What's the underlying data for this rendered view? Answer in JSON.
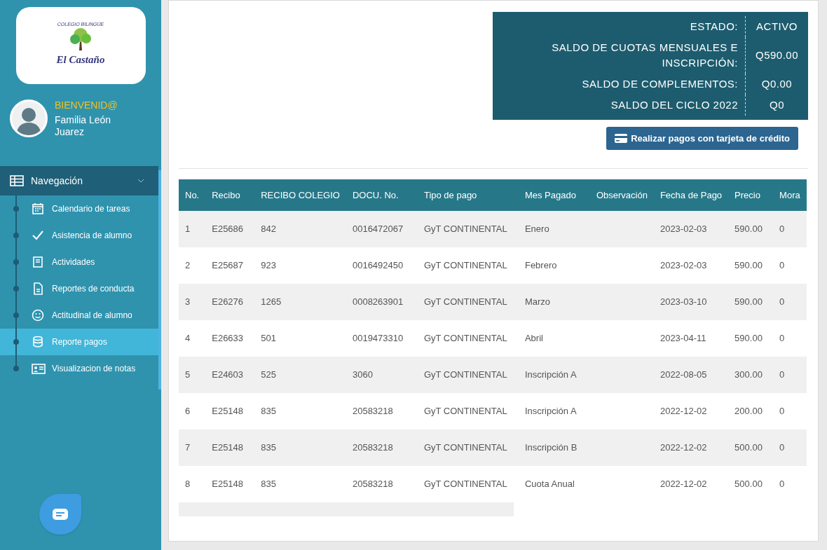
{
  "sidebar": {
    "logo": {
      "arc_text": "COLEGIO BILINGÜE",
      "name": "El Castaño"
    },
    "welcome": "BIENVENID@",
    "user_name": "Familia León Juarez",
    "nav_header": {
      "label": "Navegación",
      "expanded": true
    },
    "items": [
      {
        "label": "Calendario de tareas",
        "selected": false
      },
      {
        "label": "Asistencia de alumno",
        "selected": false
      },
      {
        "label": "Actividades",
        "selected": false
      },
      {
        "label": "Reportes de conducta",
        "selected": false
      },
      {
        "label": "Actitudinal de alumno",
        "selected": false
      },
      {
        "label": "Reporte pagos",
        "selected": true
      },
      {
        "label": "Visualizacion de notas",
        "selected": false
      }
    ]
  },
  "summary": [
    {
      "label": "ESTADO:",
      "value": "ACTIVO"
    },
    {
      "label": "SALDO DE CUOTAS MENSUALES E INSCRIPCIÓN:",
      "value": "Q590.00"
    },
    {
      "label": "SALDO DE COMPLEMENTOS:",
      "value": "Q0.00"
    },
    {
      "label": "SALDO DEL CICLO 2022",
      "value": "Q0"
    }
  ],
  "pay_button": "Realizar pagos con tarjeta de crédito",
  "table": {
    "columns": [
      "No.",
      "Recibo",
      "RECIBO COLEGIO",
      "DOCU. No.",
      "Tipo de pago",
      "Mes Pagado",
      "Observación",
      "Fecha de Pago",
      "Precio",
      "Mora"
    ],
    "rows": [
      [
        "1",
        "E25686",
        "842",
        "0016472067",
        "GyT CONTINENTAL",
        "Enero",
        "",
        "2023-02-03",
        "590.00",
        "0"
      ],
      [
        "2",
        "E25687",
        "923",
        "0016492450",
        "GyT CONTINENTAL",
        "Febrero",
        "",
        "2023-02-03",
        "590.00",
        "0"
      ],
      [
        "3",
        "E26276",
        "1265",
        "0008263901",
        "GyT CONTINENTAL",
        "Marzo",
        "",
        "2023-03-10",
        "590.00",
        "0"
      ],
      [
        "4",
        "E26633",
        "501",
        "0019473310",
        "GyT CONTINENTAL",
        "Abril",
        "",
        "2023-04-11",
        "590.00",
        "0"
      ],
      [
        "5",
        "E24603",
        "525",
        "3060",
        "GyT CONTINENTAL",
        "Inscripción A",
        "",
        "2022-08-05",
        "300.00",
        "0"
      ],
      [
        "6",
        "E25148",
        "835",
        "20583218",
        "GyT CONTINENTAL",
        "Inscripción A",
        "",
        "2022-12-02",
        "200.00",
        "0"
      ],
      [
        "7",
        "E25148",
        "835",
        "20583218",
        "GyT CONTINENTAL",
        "Inscripción B",
        "",
        "2022-12-02",
        "500.00",
        "0"
      ],
      [
        "8",
        "E25148",
        "835",
        "20583218",
        "GyT CONTINENTAL",
        "Cuota Anual",
        "",
        "2022-12-02",
        "500.00",
        "0"
      ]
    ]
  }
}
